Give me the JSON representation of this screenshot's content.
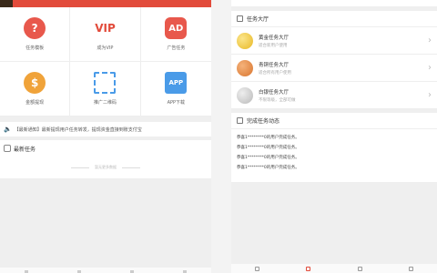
{
  "left": {
    "grid": [
      {
        "icon": "question-icon",
        "glyph": "?",
        "label": "任务模板"
      },
      {
        "icon": "vip-badge-icon",
        "glyph": "VIP",
        "label": "成为VIP"
      },
      {
        "icon": "ad-icon",
        "glyph": "AD",
        "label": "广告任务"
      },
      {
        "icon": "money-bag-icon",
        "glyph": "$",
        "label": "金额提现"
      },
      {
        "icon": "qr-scan-icon",
        "glyph": "",
        "label": "推广二维码"
      },
      {
        "icon": "app-icon",
        "glyph": "APP",
        "label": "APP下载"
      }
    ],
    "notice": {
      "tag": "【最新通知】",
      "text": "最新提现用户任务转发，提现资金直接到账支付宝"
    },
    "latest_label": "最新任务",
    "no_more": "暂无更多数据"
  },
  "right": {
    "task_hall_title": "任务大厅",
    "halls": [
      {
        "title": "黄金任务大厅",
        "subtitle": "适合新用户使用",
        "tone": "gold"
      },
      {
        "title": "青铜任务大厅",
        "subtitle": "适合所有用户使用",
        "tone": "bronze"
      },
      {
        "title": "白银任务大厅",
        "subtitle": "不限等级，全部可做",
        "tone": "silver"
      }
    ],
    "records_title": "完成任务动态",
    "records": [
      "恭喜1********0的用户完成任务。",
      "恭喜1********0的用户完成任务。",
      "恭喜1********0的用户完成任务。",
      "恭喜1********0的用户完成任务。"
    ]
  }
}
